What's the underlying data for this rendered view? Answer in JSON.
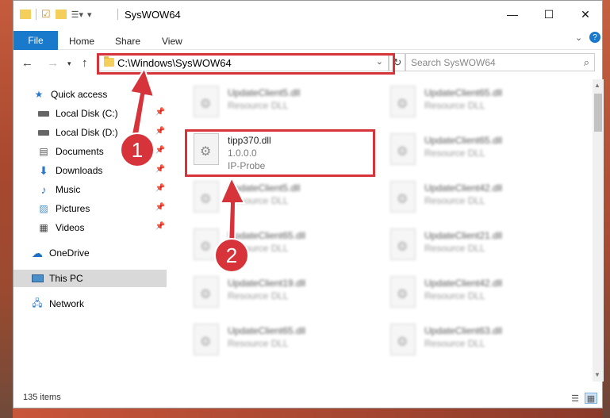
{
  "window": {
    "title": "SysWOW64"
  },
  "ribbon": {
    "file_tab": "File",
    "tabs": [
      "Home",
      "Share",
      "View"
    ]
  },
  "address": {
    "path": "C:\\Windows\\SysWOW64"
  },
  "search": {
    "placeholder": "Search SysWOW64"
  },
  "nav": {
    "items": [
      {
        "label": "Quick access",
        "icon": "star-icon"
      },
      {
        "label": "Local Disk (C:)",
        "icon": "drive-icon"
      },
      {
        "label": "Local Disk (D:)",
        "icon": "drive-icon"
      },
      {
        "label": "Documents",
        "icon": "documents-icon"
      },
      {
        "label": "Downloads",
        "icon": "download-icon"
      },
      {
        "label": "Music",
        "icon": "music-icon"
      },
      {
        "label": "Pictures",
        "icon": "pictures-icon"
      },
      {
        "label": "Videos",
        "icon": "videos-icon"
      },
      {
        "label": "OneDrive",
        "icon": "cloud-icon"
      },
      {
        "label": "This PC",
        "icon": "computer-icon"
      },
      {
        "label": "Network",
        "icon": "network-icon"
      }
    ]
  },
  "files": {
    "highlighted": {
      "name": "tipp370.dll",
      "version": "1.0.0.0",
      "description": "IP-Probe"
    },
    "left": [
      {
        "name": "UpdateClient5.dll",
        "type": "Resource DLL"
      },
      {
        "name": "UpdateClient5.dll",
        "type": "Resource DLL"
      },
      {
        "name": "UpdateClient65.dll",
        "type": "Resource DLL"
      },
      {
        "name": "UpdateClient19.dll",
        "type": "Resource DLL"
      },
      {
        "name": "UpdateClient65.dll",
        "type": "Resource DLL"
      }
    ],
    "right": [
      {
        "name": "UpdateClient65.dll",
        "type": "Resource DLL"
      },
      {
        "name": "UpdateClient65.dll",
        "type": "Resource DLL"
      },
      {
        "name": "UpdateClient42.dll",
        "type": "Resource DLL"
      },
      {
        "name": "UpdateClient21.dll",
        "type": "Resource DLL"
      },
      {
        "name": "UpdateClient42.dll",
        "type": "Resource DLL"
      },
      {
        "name": "UpdateClient63.dll",
        "type": "Resource DLL"
      }
    ]
  },
  "status": {
    "item_count": "135 items"
  },
  "annotations": {
    "badge1": "1",
    "badge2": "2",
    "color": "#d6343a"
  }
}
